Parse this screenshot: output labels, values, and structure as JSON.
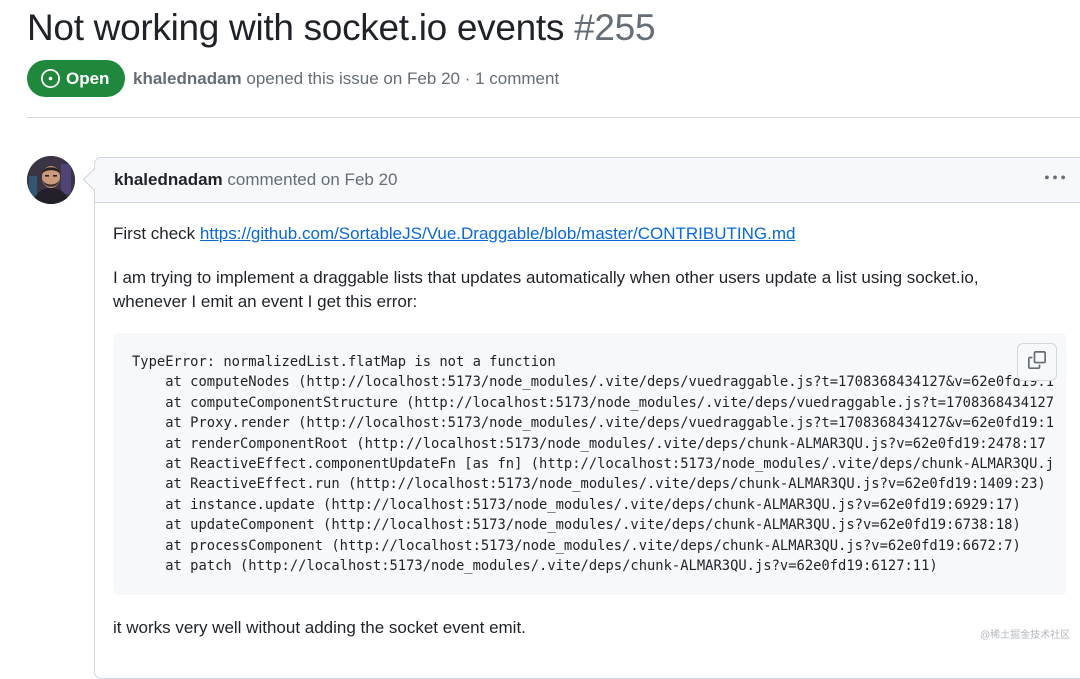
{
  "issue": {
    "title": "Not working with socket.io events",
    "number": "#255",
    "state_label": "Open",
    "author": "khalednadam",
    "meta_text": " opened this issue on Feb 20 · 1 comment"
  },
  "comment": {
    "author": "khalednadam",
    "action_text": " commented on Feb 20",
    "intro_prefix": "First check ",
    "link_text": "https://github.com/SortableJS/Vue.Draggable/blob/master/CONTRIBUTING.md",
    "paragraph": "I am trying to implement a draggable lists that updates automatically when other users update a list using socket.io, whenever I emit an event I get this error:",
    "code_lines": [
      "TypeError: normalizedList.flatMap is not a function",
      "    at computeNodes (http://localhost:5173/node_modules/.vite/deps/vuedraggable.js?t=1708368434127&v=62e0fd19:1",
      "    at computeComponentStructure (http://localhost:5173/node_modules/.vite/deps/vuedraggable.js?t=1708368434127",
      "    at Proxy.render (http://localhost:5173/node_modules/.vite/deps/vuedraggable.js?t=1708368434127&v=62e0fd19:1",
      "    at renderComponentRoot (http://localhost:5173/node_modules/.vite/deps/chunk-ALMAR3QU.js?v=62e0fd19:2478:17",
      "    at ReactiveEffect.componentUpdateFn [as fn] (http://localhost:5173/node_modules/.vite/deps/chunk-ALMAR3QU.j",
      "    at ReactiveEffect.run (http://localhost:5173/node_modules/.vite/deps/chunk-ALMAR3QU.js?v=62e0fd19:1409:23)",
      "    at instance.update (http://localhost:5173/node_modules/.vite/deps/chunk-ALMAR3QU.js?v=62e0fd19:6929:17)",
      "    at updateComponent (http://localhost:5173/node_modules/.vite/deps/chunk-ALMAR3QU.js?v=62e0fd19:6738:18)",
      "    at processComponent (http://localhost:5173/node_modules/.vite/deps/chunk-ALMAR3QU.js?v=62e0fd19:6672:7)",
      "    at patch (http://localhost:5173/node_modules/.vite/deps/chunk-ALMAR3QU.js?v=62e0fd19:6127:11)"
    ],
    "closing": "it works very well without adding the socket event emit."
  },
  "watermark": "@稀土掘金技术社区",
  "icons": {
    "state": "issue-opened-icon",
    "menu": "kebab-horizontal-icon",
    "copy": "copy-icon",
    "avatar": "avatar"
  },
  "colors": {
    "open_green": "#1f883d",
    "link_blue": "#0969da",
    "muted_text": "#656d76",
    "border": "#d0d7de",
    "canvas_subtle": "#f6f8fa"
  }
}
